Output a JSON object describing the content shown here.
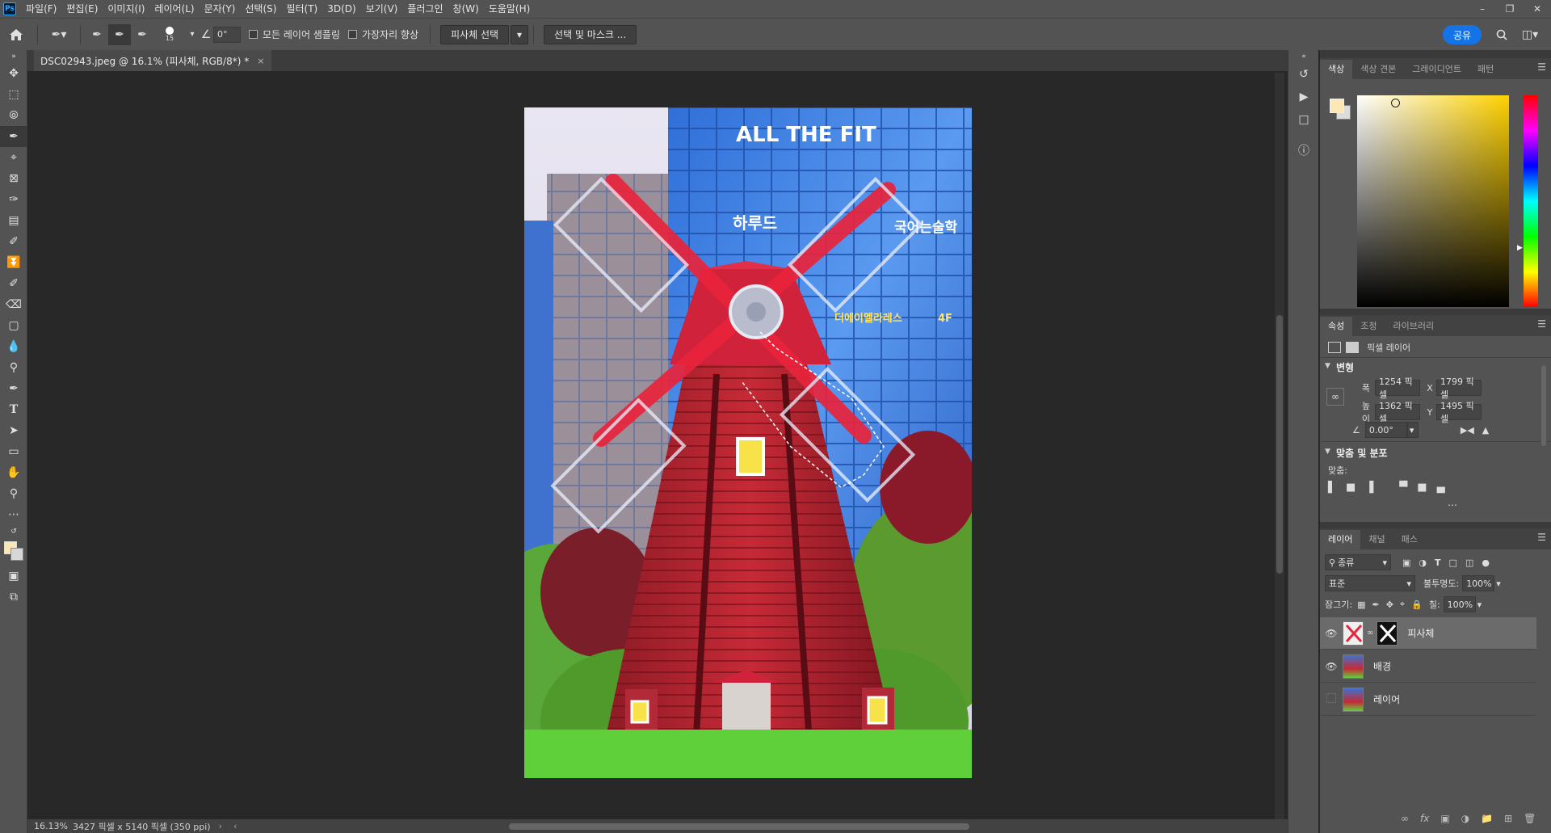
{
  "app": {
    "logo": "Ps"
  },
  "menu": [
    "파일(F)",
    "편집(E)",
    "이미지(I)",
    "레이어(L)",
    "문자(Y)",
    "선택(S)",
    "필터(T)",
    "3D(D)",
    "보기(V)",
    "플러그인",
    "창(W)",
    "도움말(H)"
  ],
  "options": {
    "brush_size": "15",
    "angle": "0°",
    "sample_all_layers": "모든 레이어 샘플링",
    "enhance_edge": "가장자리 향상",
    "select_subject": "피사체 선택",
    "select_and_mask": "선택 및 마스크 ...",
    "share": "공유"
  },
  "document": {
    "tab_title": "DSC02943.jpeg @ 16.1% (피사체, RGB/8*) *",
    "close": "×"
  },
  "status": {
    "zoom": "16.13%",
    "info": "3427 픽셀 x 5140 픽셀 (350 ppi)"
  },
  "photo_text": {
    "sign_top": "ALL THE FIT",
    "sign_mid_left": "하루드",
    "sign_mid_right": "국어는술학",
    "sign_lower": "더에이멜라레스",
    "sign_floor": "4F"
  },
  "color_panel": {
    "tabs": [
      "색상",
      "색상 견본",
      "그레이디언트",
      "패턴"
    ],
    "foreground": "#fbe8b4",
    "background": "#dcdcdc"
  },
  "properties_panel": {
    "tabs": [
      "속성",
      "조정",
      "라이브러리"
    ],
    "layer_type": "픽셀 레이어",
    "transform_title": "변형",
    "width_label": "폭",
    "width": "1254 픽셀",
    "height_label": "높이",
    "height": "1362 픽셀",
    "x_label": "X",
    "x": "1799 픽셀",
    "y_label": "Y",
    "y": "1495 픽셀",
    "angle": "0.00°",
    "align_title": "맞춤 및 분포",
    "align_label": "맞춤:"
  },
  "layers_panel": {
    "tabs": [
      "레이어",
      "채널",
      "패스"
    ],
    "filter": "종류",
    "blend_mode": "표준",
    "opacity_label": "불투명도:",
    "opacity": "100%",
    "lock_label": "잠그기:",
    "fill_label": "칠:",
    "fill": "100%",
    "layers": [
      {
        "name": "피사체",
        "visible": true,
        "selected": true
      },
      {
        "name": "배경",
        "visible": true,
        "selected": false
      },
      {
        "name": "레이어",
        "visible": false,
        "selected": false
      }
    ]
  }
}
